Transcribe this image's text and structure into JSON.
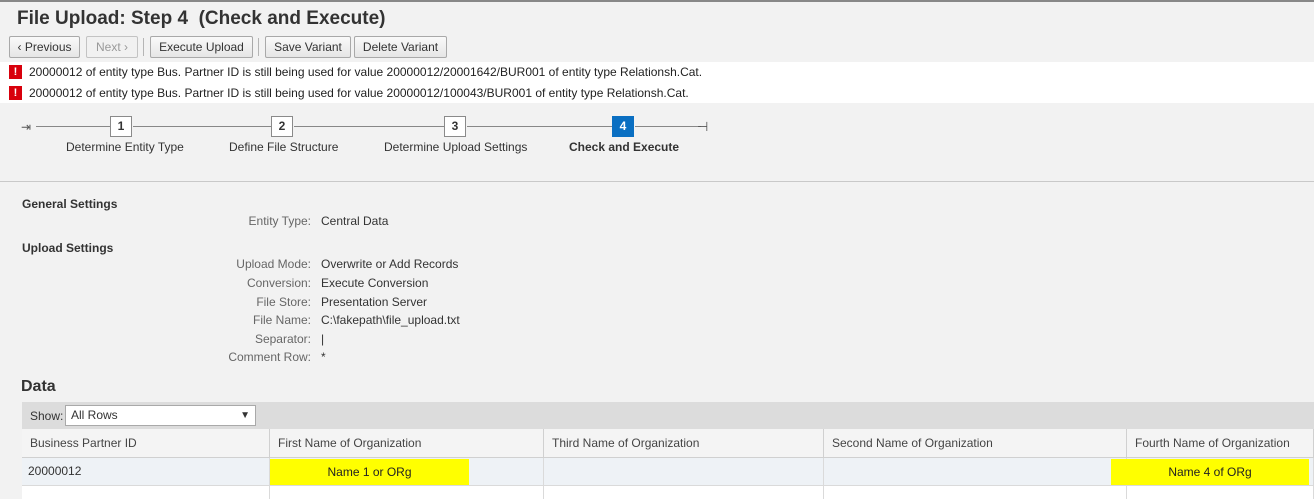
{
  "header": {
    "title": "File Upload: Step 4  (Check and Execute)"
  },
  "toolbar": {
    "previous": "‹ Previous",
    "next": "Next ›",
    "execute": "Execute Upload",
    "save_variant": "Save Variant",
    "delete_variant": "Delete Variant"
  },
  "messages": [
    {
      "icon": "error-icon",
      "text": "20000012 of entity type Bus. Partner ID is still being used for value 20000012/20001642/BUR001 of entity type Relationsh.Cat."
    },
    {
      "icon": "error-icon",
      "text": "20000012 of entity type Bus. Partner ID is still being used for value 20000012/100043/BUR001 of entity type Relationsh.Cat."
    }
  ],
  "roadmap": {
    "steps": [
      {
        "number": "1",
        "label": "Determine Entity Type"
      },
      {
        "number": "2",
        "label": "Define File Structure"
      },
      {
        "number": "3",
        "label": "Determine Upload Settings"
      },
      {
        "number": "4",
        "label": "Check and Execute"
      }
    ],
    "active_step": "4"
  },
  "general": {
    "title": "General Settings",
    "entity_type_label": "Entity Type:",
    "entity_type_value": "Central Data"
  },
  "upload": {
    "title": "Upload Settings",
    "fields": [
      {
        "label": "Upload Mode:",
        "value": "Overwrite or Add Records"
      },
      {
        "label": "Conversion:",
        "value": "Execute Conversion"
      },
      {
        "label": "File Store:",
        "value": "Presentation Server"
      },
      {
        "label": "File Name:",
        "value": "C:\\fakepath\\file_upload.txt"
      },
      {
        "label": "Separator:",
        "value": "|"
      },
      {
        "label": "Comment Row:",
        "value": "*"
      }
    ]
  },
  "data": {
    "title": "Data",
    "show_label": "Show:",
    "show_value": "All Rows",
    "columns": [
      "Business Partner ID",
      "First Name of Organization",
      "Third Name of Organization",
      "Second Name of Organization",
      "Fourth Name of Organization"
    ],
    "rows": [
      [
        "20000012",
        "Name 1 or ORg",
        "",
        "",
        "Name 4 of ORg"
      ]
    ]
  },
  "colors": {
    "active_step": "#0a6fc2",
    "error": "#d8000c",
    "highlight": "#ffff00"
  }
}
